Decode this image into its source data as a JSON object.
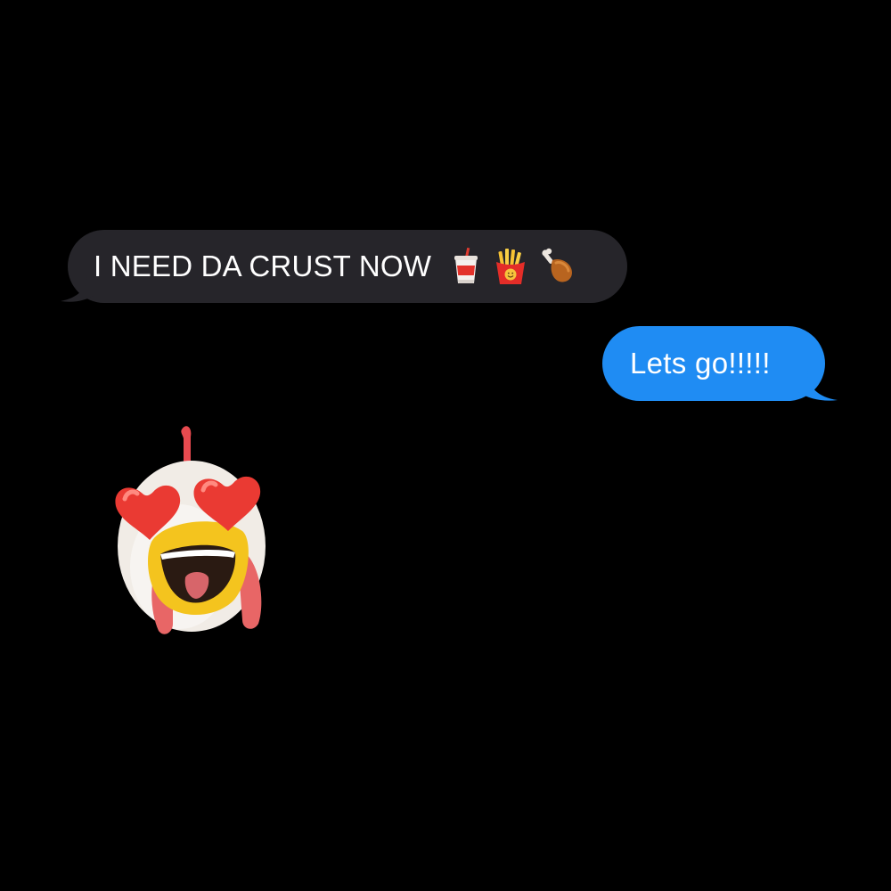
{
  "messages": [
    {
      "direction": "received",
      "text": "I NEED DA CRUST NOW",
      "emoji": [
        "cup-with-straw-icon",
        "french-fries-icon",
        "poultry-leg-icon"
      ]
    },
    {
      "direction": "sent",
      "text": "Lets go!!!!!"
    },
    {
      "direction": "received",
      "sticker": "chicken-animoji-heart-eyes-icon"
    }
  ],
  "colors": {
    "background": "#000000",
    "received_bubble": "#26252a",
    "sent_bubble": "#1f8cf3",
    "text": "#ffffff"
  }
}
